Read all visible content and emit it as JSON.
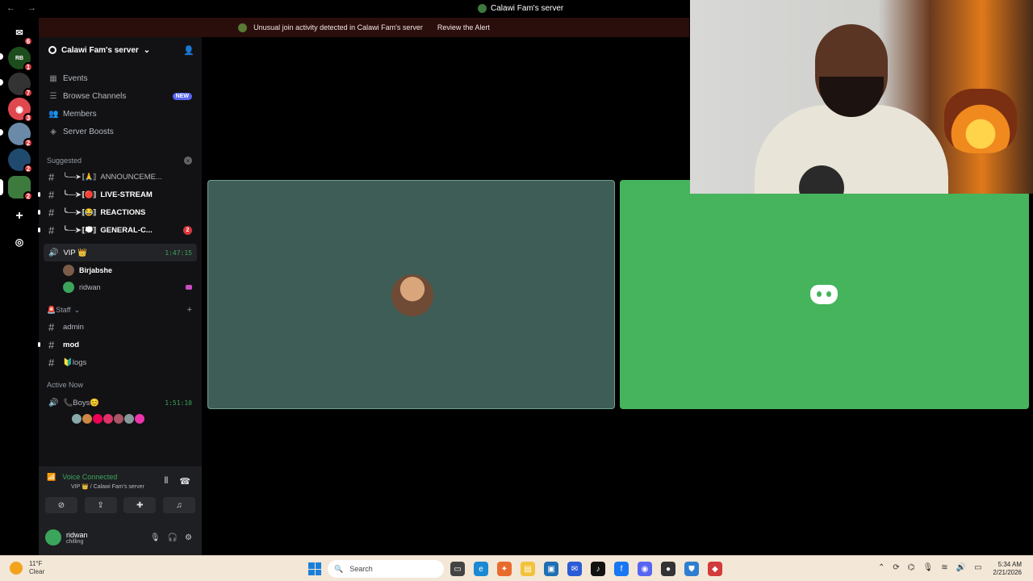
{
  "titlebar": {
    "title": "Calawi Fam's server",
    "nav": "← →"
  },
  "alert": {
    "message": "Unusual join activity detected in Calawi Fam's server",
    "action": "Review the Alert"
  },
  "rail": {
    "badges": [
      "6",
      "1",
      "7",
      "3",
      "2",
      "2",
      "2"
    ]
  },
  "server": {
    "name": "Calawi Fam's server",
    "menu": [
      {
        "icon": "calendar-icon",
        "label": "Events"
      },
      {
        "icon": "browse-icon",
        "label": "Browse Channels",
        "badge": "NEW"
      },
      {
        "icon": "members-icon",
        "label": "Members"
      },
      {
        "icon": "boost-icon",
        "label": "Server Boosts"
      }
    ],
    "suggested_label": "Suggested",
    "suggested": [
      {
        "arrow": "╰──➤ ⟦🙏⟧",
        "name": "ANNOUNCEME...",
        "dim": true
      },
      {
        "arrow": "╰──➤ ⟦🔴⟧",
        "name": "LIVE-STREAM"
      },
      {
        "arrow": "╰──➤ ⟦😂⟧",
        "name": "REACTIONS"
      },
      {
        "arrow": "╰──➤ ⟦💭⟧",
        "name": "GENERAL-C...",
        "mentions": "2"
      }
    ],
    "voice": {
      "name": "VIP 👑",
      "timer": "1:47:15",
      "members": [
        "Birjabshe",
        "ridwan"
      ]
    },
    "staff_category": "🚨Staff",
    "staff_channels": [
      "admin",
      "mod",
      "🔰logs"
    ],
    "active_now_label": "Active Now",
    "active": {
      "name": "📞Boys😊",
      "timer": "1:51:10"
    }
  },
  "panel": {
    "status": "Voice Connected",
    "location": "VIP 👑 / Calawi Fam's server",
    "username": "ridwan",
    "user_status": "chilling"
  },
  "taskbar": {
    "temperature": "11°F",
    "condition": "Clear",
    "search_placeholder": "Search",
    "time": "5:34 AM",
    "date": "2/21/2026"
  },
  "colors": {
    "accent": "#3ba55c",
    "alert_bg": "#2a0e0c",
    "tile_green": "#45b45d",
    "tile_teal": "#3f5d57"
  }
}
